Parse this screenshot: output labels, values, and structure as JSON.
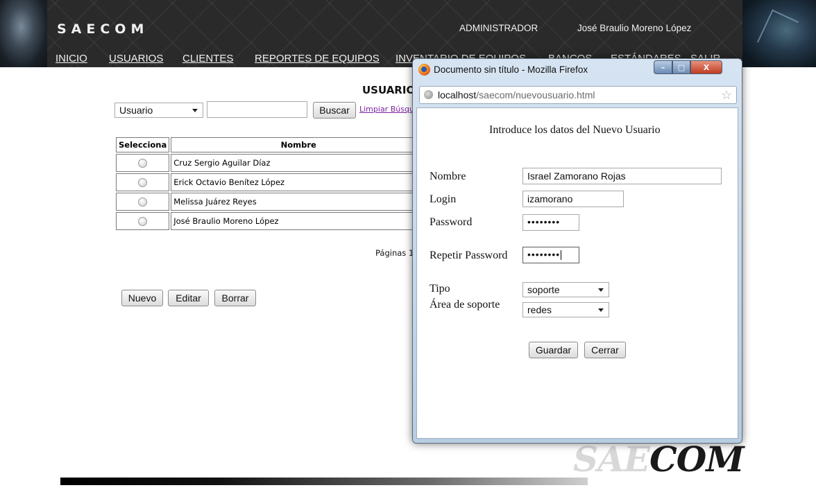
{
  "header": {
    "brand": "SAECOM",
    "role": "ADMINISTRADOR",
    "user_name": "José Braulio Moreno López",
    "nav": [
      "INICIO",
      "USUARIOS",
      "CLIENTES",
      "REPORTES DE EQUIPOS",
      "INVENTARIO DE EQUIPOS",
      "BANCOS",
      "ESTÁNDARES",
      "SALIR"
    ]
  },
  "page": {
    "title": "USUARIOS",
    "search_field_selected": "Usuario",
    "search_value": "",
    "search_button": "Buscar",
    "clear_link": "Limpiar Búsqueda",
    "table": {
      "headers": [
        "Selecciona",
        "Nombre"
      ],
      "rows": [
        "Cruz Sergio Aguilar Díaz",
        "Erick Octavio Benítez López",
        "Melissa Juárez Reyes",
        "José Braulio Moreno López"
      ]
    },
    "pages_label": "Páginas 1",
    "buttons": {
      "new": "Nuevo",
      "edit": "Editar",
      "delete": "Borrar"
    }
  },
  "popup": {
    "window_title": "Documento sin título - Mozilla Firefox",
    "url_host": "localhost",
    "url_path": "/saecom/nuevousuario.html",
    "form_title": "Introduce los datos del Nuevo Usuario",
    "labels": {
      "name": "Nombre",
      "login": "Login",
      "password": "Password",
      "repeat_password": "Repetir Password",
      "type": "Tipo",
      "support_area": "Área de soporte"
    },
    "values": {
      "name": "Israel Zamorano Rojas",
      "login": "izamorano",
      "password": "••••••••",
      "repeat_password": "••••••••",
      "type": "soporte",
      "support_area": "redes"
    },
    "buttons": {
      "save": "Guardar",
      "close": "Cerrar"
    },
    "controls": {
      "minimize": "–",
      "maximize": "□",
      "close": "X"
    }
  },
  "footer": {
    "logo_light": "SAE",
    "logo_dark": "COM"
  }
}
